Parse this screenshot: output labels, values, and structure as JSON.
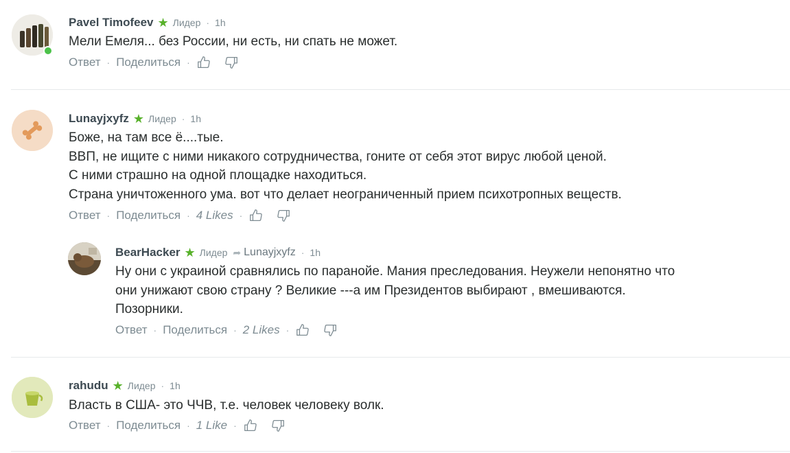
{
  "comments": [
    {
      "username": "Pavel Timofeev",
      "badge": "Лидер",
      "time": "1h",
      "body": [
        "Мели Емеля... без России, ни есть, ни спать не может."
      ],
      "reply_label": "Ответ",
      "share_label": "Поделиться",
      "likes": "",
      "online": true
    },
    {
      "username": "Lunayjxyfz",
      "badge": "Лидер",
      "time": "1h",
      "body": [
        "Боже,  на там все ё....тые.",
        "ВВП, не ищите с ними никакого сотрудничества, гоните от себя этот вирус любой ценой.",
        "С ними страшно  на одной площадке находиться.",
        "Страна уничтоженного ума. вот что делает неограниченный прием психотропных веществ."
      ],
      "reply_label": "Ответ",
      "share_label": "Поделиться",
      "likes": "4 Likes"
    },
    {
      "username": "BearHacker",
      "badge": "Лидер",
      "reply_to": "Lunayjxyfz",
      "time": "1h",
      "body": [
        "Ну они с украиной сравнялись  по паранойе.  Мания преследования.  Неужели  непонятно что",
        "они унижают свою страну ?  Великие ---а  им Президентов выбирают , вмешиваются.",
        "Позорники."
      ],
      "reply_label": "Ответ",
      "share_label": "Поделиться",
      "likes": "2 Likes"
    },
    {
      "username": "rahudu",
      "badge": "Лидер",
      "time": "1h",
      "body": [
        "Власть в США- это ЧЧВ, т.е. человек человеку волк."
      ],
      "reply_label": "Ответ",
      "share_label": "Поделиться",
      "likes": "1 Like"
    }
  ],
  "icons": {
    "star": "star-icon",
    "like": "thumbs-up-icon",
    "dislike": "thumbs-down-icon",
    "reply_arrow": "reply-arrow-icon"
  },
  "colors": {
    "leader_star": "#58b12b",
    "online": "#4cc24a",
    "divider": "#e6e9eb"
  }
}
